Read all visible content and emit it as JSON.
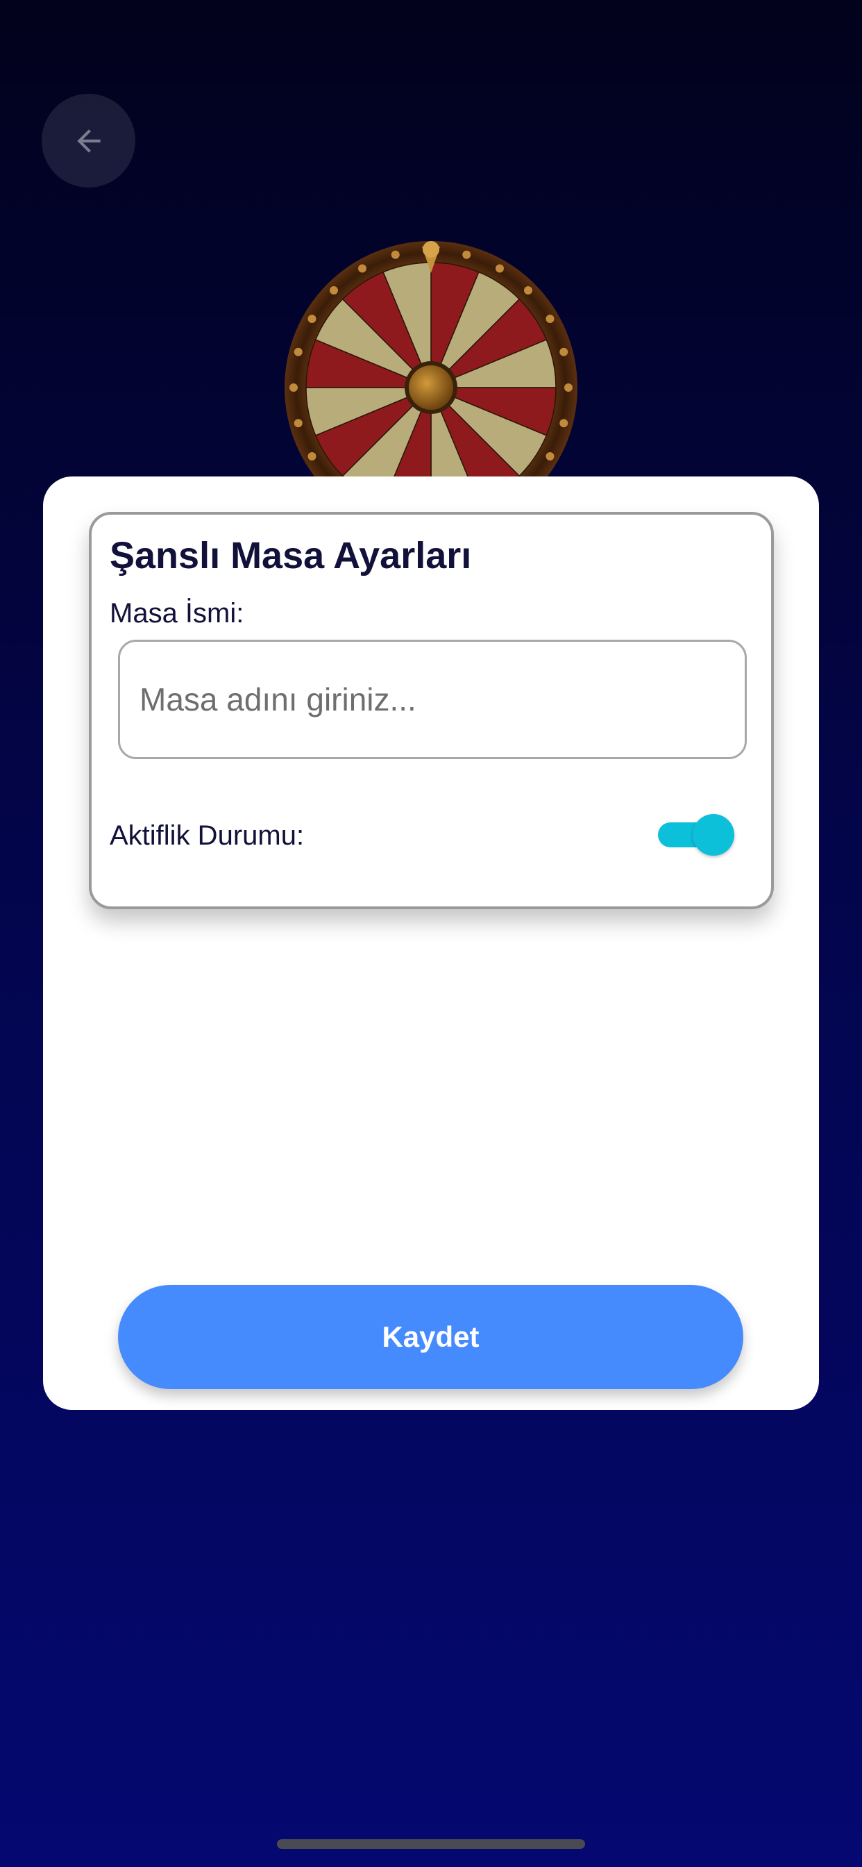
{
  "header": {
    "back_icon": "arrow-left-icon"
  },
  "hero": {
    "image": "wheel-of-fortune-icon",
    "slice_colors": [
      "#8e1a1e",
      "#b8ad7a"
    ]
  },
  "settings": {
    "title": "Şanslı Masa Ayarları",
    "name_label": "Masa İsmi:",
    "name_value": "",
    "name_placeholder": "Masa adını giriniz...",
    "active_label": "Aktiflik Durumu:",
    "active_on": true
  },
  "actions": {
    "save_label": "Kaydet"
  },
  "colors": {
    "background_top": "#02021c",
    "background_bottom": "#040870",
    "accent_button": "#468bfd",
    "toggle_on": "#0cc0da",
    "title_text": "#11113a"
  }
}
